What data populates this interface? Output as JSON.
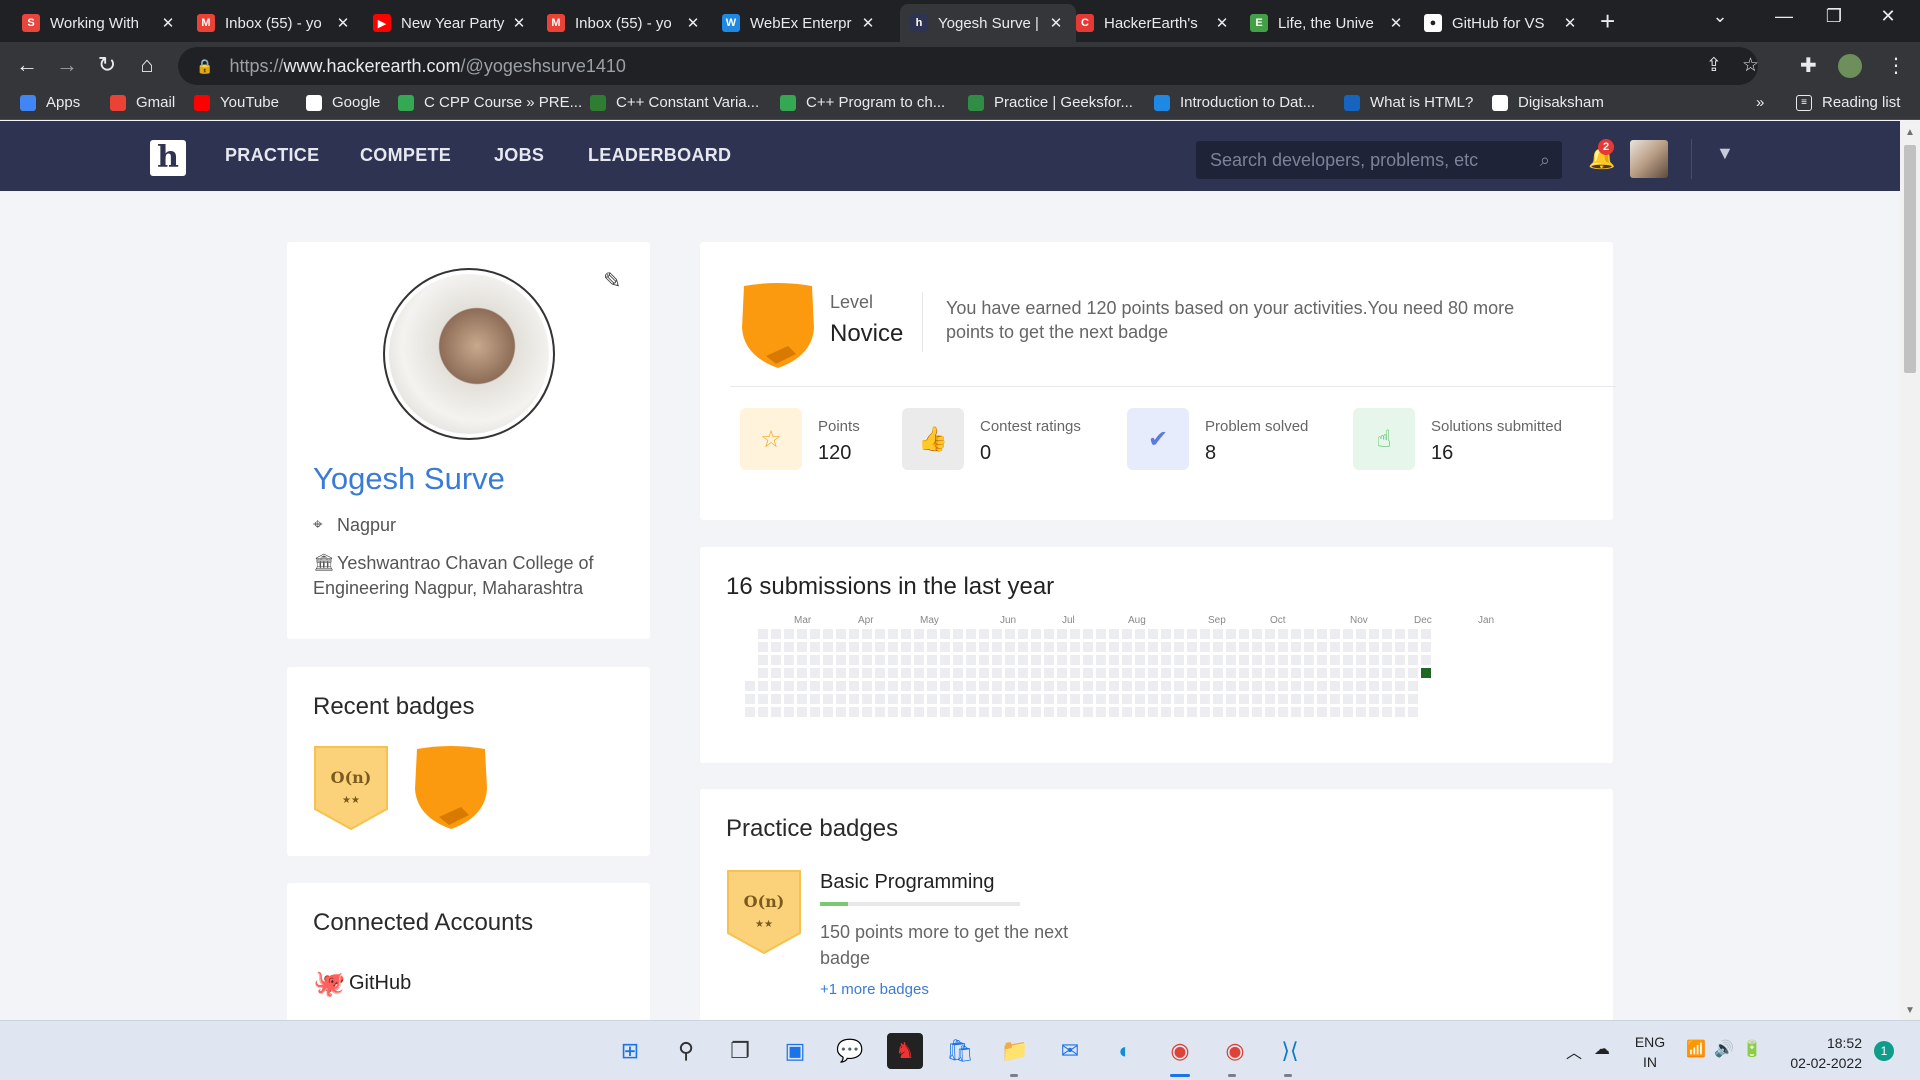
{
  "browser": {
    "tabs": [
      {
        "title": "Working With",
        "color": "#e8453c",
        "glyph": "S"
      },
      {
        "title": "Inbox (55) - yo",
        "color": "#ea4335",
        "glyph": "M"
      },
      {
        "title": "New Year Party",
        "color": "#ff0000",
        "glyph": "▶"
      },
      {
        "title": "Inbox (55) - yo",
        "color": "#ea4335",
        "glyph": "M"
      },
      {
        "title": "WebEx Enterpr",
        "color": "#1e88e5",
        "glyph": "W"
      },
      {
        "title": "Yogesh Surve |",
        "color": "#2e3351",
        "glyph": "h"
      },
      {
        "title": "HackerEarth's",
        "color": "#e53935",
        "glyph": "C"
      },
      {
        "title": "Life, the Unive",
        "color": "#43a047",
        "glyph": "E"
      },
      {
        "title": "GitHub for VS",
        "color": "#ffffff",
        "glyph": "●"
      }
    ],
    "url_prefix": "https://",
    "url_host": "www.hackerearth.com",
    "url_path": "/@yogeshsurve1410",
    "bookmarks": [
      {
        "label": "Apps",
        "color": "#4285f4"
      },
      {
        "label": "Gmail",
        "color": "#ea4335"
      },
      {
        "label": "YouTube",
        "color": "#ff0000"
      },
      {
        "label": "Google",
        "color": "#ffffff"
      },
      {
        "label": "C CPP Course » PRE...",
        "color": "#34a853"
      },
      {
        "label": "C++ Constant Varia...",
        "color": "#2e7d32"
      },
      {
        "label": "C++ Program to ch...",
        "color": "#34a853"
      },
      {
        "label": "Practice | Geeksfor...",
        "color": "#2f8d46"
      },
      {
        "label": "Introduction to Dat...",
        "color": "#1e88e5"
      },
      {
        "label": "What is HTML?",
        "color": "#1565c0"
      },
      {
        "label": "Digisaksham",
        "color": "#ffffff"
      }
    ],
    "more_bookmarks": "»",
    "reading_list": "Reading list"
  },
  "site": {
    "logo": "h",
    "nav": [
      "PRACTICE",
      "COMPETE",
      "JOBS",
      "LEADERBOARD"
    ],
    "search_placeholder": "Search developers, problems, etc",
    "notification_count": "2"
  },
  "profile": {
    "name": "Yogesh Surve",
    "location": "Nagpur",
    "college_line1": "Yeshwantrao Chavan College of",
    "college_line2": "Engineering Nagpur, Maharashtra"
  },
  "recent_badges": {
    "title": "Recent badges",
    "badges": [
      {
        "text": "O(n)",
        "stars": "★★"
      },
      {
        "text": "",
        "stars": ""
      }
    ]
  },
  "connected_accounts": {
    "title": "Connected Accounts",
    "items": [
      "GitHub"
    ]
  },
  "level": {
    "label": "Level",
    "value": "Novice",
    "message": "You have earned 120 points based on your activities.You need 80 more points to get the next badge"
  },
  "stats": [
    {
      "label": "Points",
      "value": "120",
      "icon": "star-icon",
      "glyph": "☆",
      "bg": "#fff3dc",
      "fg": "#f5a623"
    },
    {
      "label": "Contest ratings",
      "value": "0",
      "icon": "thumbs-up-icon",
      "glyph": "👍",
      "bg": "#ebebeb",
      "fg": "#888888"
    },
    {
      "label": "Problem solved",
      "value": "8",
      "icon": "check-circle-icon",
      "glyph": "✔",
      "bg": "#e6ecfb",
      "fg": "#5b7be0"
    },
    {
      "label": "Solutions submitted",
      "value": "16",
      "icon": "pointer-hand-icon",
      "glyph": "☝",
      "bg": "#e6f6ea",
      "fg": "#3bb54a"
    }
  ],
  "submissions": {
    "title": "16 submissions in the last year",
    "months": [
      "Mar",
      "Apr",
      "May",
      "Jun",
      "Jul",
      "Aug",
      "Sep",
      "Oct",
      "Nov",
      "Dec",
      "Jan"
    ],
    "active_color": "#1e6823",
    "empty_color": "#ebedf0"
  },
  "practice_badges": {
    "title": "Practice badges",
    "items": [
      {
        "name": "Basic Programming",
        "desc": "150 points more to get the next badge",
        "progress": 0.14,
        "badge_text": "O(n)",
        "badge_stars": "★★"
      }
    ],
    "more_link": "+1 more badges"
  },
  "taskbar": {
    "lang": "ENG",
    "region": "IN",
    "time": "18:52",
    "date": "02-02-2022",
    "notifications": "1"
  }
}
